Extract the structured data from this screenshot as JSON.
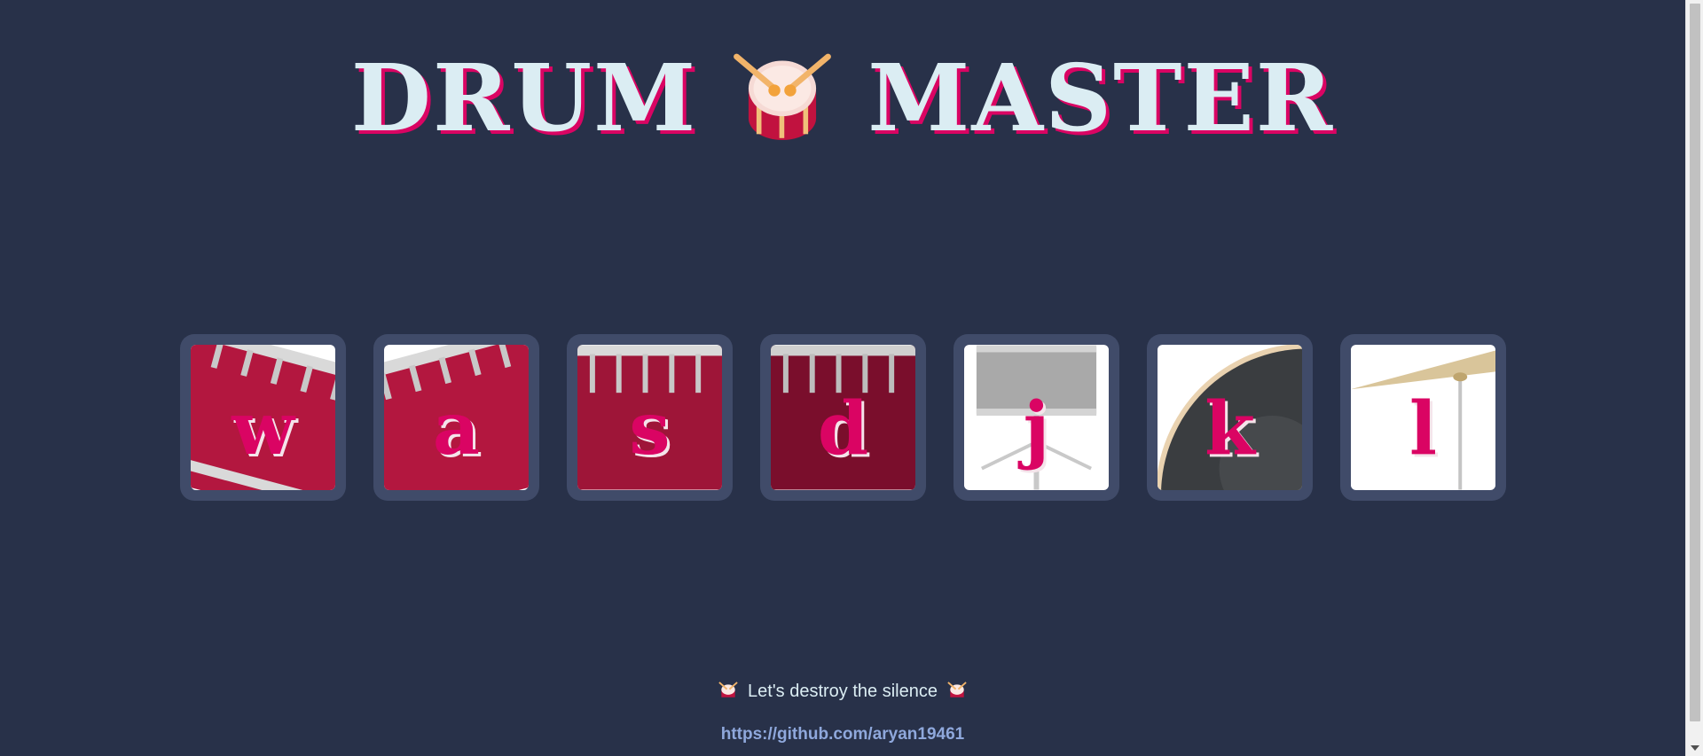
{
  "header": {
    "title_left": "DRUM",
    "title_right": "MASTER",
    "icon": "drum-icon"
  },
  "pads": [
    {
      "key": "w",
      "art": "tom-tilted-right"
    },
    {
      "key": "a",
      "art": "tom-tilted-left"
    },
    {
      "key": "s",
      "art": "floor-tom"
    },
    {
      "key": "d",
      "art": "floor-tom-dark"
    },
    {
      "key": "j",
      "art": "snare"
    },
    {
      "key": "k",
      "art": "kick"
    },
    {
      "key": "l",
      "art": "cymbal"
    }
  ],
  "footer": {
    "message": "Let's destroy the silence",
    "link": "https://github.com/aryan19461"
  },
  "colors": {
    "background": "#283149",
    "pad_frame": "#404b69",
    "accent": "#da0463",
    "title": "#dbedf3",
    "link": "#8fa8dc"
  }
}
